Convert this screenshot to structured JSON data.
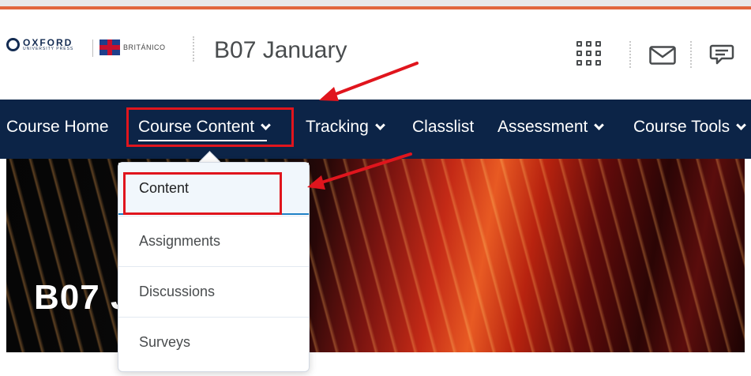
{
  "header": {
    "oxford_brand": "OXFORD",
    "oxford_sub": "UNIVERSITY PRESS",
    "britanico_brand": "BRITÁNICO",
    "course_title": "B07 January",
    "icons": [
      "app-grid-icon",
      "mail-icon",
      "chat-icon"
    ]
  },
  "navbar": {
    "items": [
      {
        "label": "Course Home",
        "has_menu": false
      },
      {
        "label": "Course Content",
        "has_menu": true,
        "active": true
      },
      {
        "label": "Tracking",
        "has_menu": true
      },
      {
        "label": "Classlist",
        "has_menu": false
      },
      {
        "label": "Assessment",
        "has_menu": true
      },
      {
        "label": "Course Tools",
        "has_menu": true
      }
    ]
  },
  "dropdown": {
    "items": [
      "Content",
      "Assignments",
      "Discussions",
      "Surveys"
    ]
  },
  "banner": {
    "title": "B07 J"
  },
  "colors": {
    "navbar_bg": "#0c2447",
    "accent_top": "#e2673d",
    "highlight": "#e0151d",
    "focus_blue": "#1e80c6"
  }
}
